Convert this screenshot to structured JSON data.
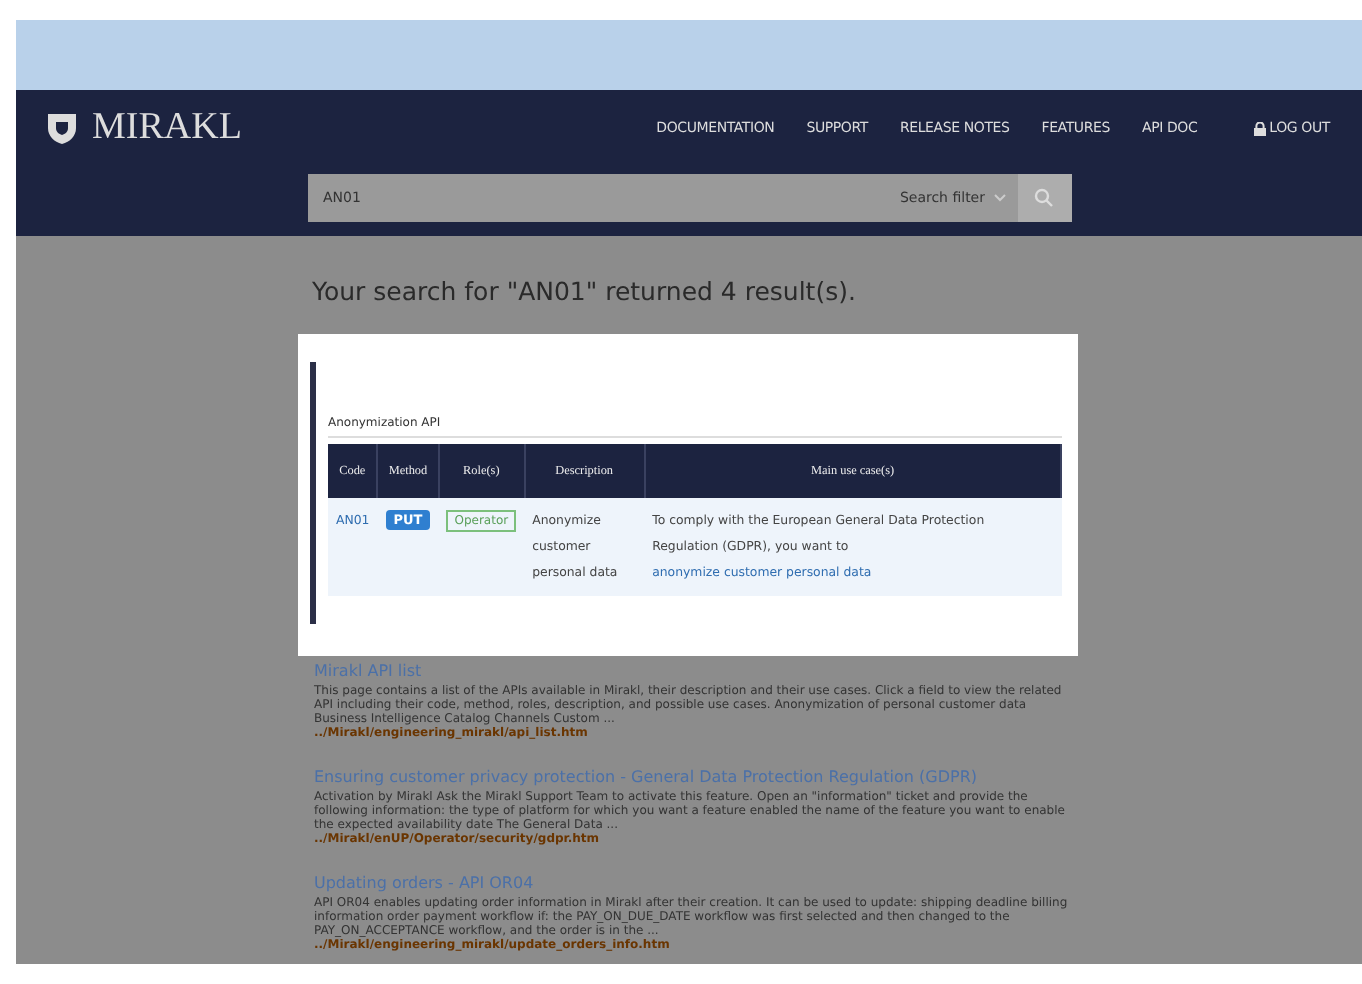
{
  "header": {
    "logo": "MIRAKL",
    "nav": [
      "DOCUMENTATION",
      "SUPPORT",
      "RELEASE NOTES",
      "FEATURES",
      "API DOC"
    ],
    "logout": "LOG OUT"
  },
  "search": {
    "value": "AN01",
    "filter": "Search filter"
  },
  "heading": "Your search for \"AN01\" returned 4 result(s).",
  "modal": {
    "section": "Anonymization API",
    "columns": [
      "Code",
      "Method",
      "Role(s)",
      "Description",
      "Main use case(s)"
    ],
    "rows": [
      {
        "code": "AN01",
        "method": "PUT",
        "role": "Operator",
        "description": "Anonymize customer personal data",
        "use_case": "To comply with the European General Data Protection Regulation (GDPR), you want to ",
        "use_case_link": "anonymize customer personal data"
      }
    ]
  },
  "results": [
    {
      "title": "Mirakl API list",
      "snippet": "This page contains a list of the APIs available in Mirakl, their description and their use cases. Click a field to view the related API including their code, method, roles, description, and possible use cases. Anonymization of personal customer data Business Intelligence Catalog Channels Custom ...",
      "url": "../Mirakl/engineering_mirakl/api_list.htm"
    },
    {
      "title": "Ensuring customer privacy protection - General Data Protection Regulation (GDPR)",
      "snippet": "Activation by Mirakl Ask the Mirakl Support Team to activate this feature. Open an \"information\" ticket and provide the following information: the type of platform for which you want a feature enabled the name of the feature you want to enable the expected availability date The General Data ...",
      "url": "../Mirakl/enUP/Operator/security/gdpr.htm"
    },
    {
      "title": "Updating orders - API OR04",
      "snippet": "API OR04 enables updating order information in Mirakl after their creation. It can be used to update: shipping deadline billing information order payment workflow if: the PAY_ON_DUE_DATE workflow was first selected and then changed to the PAY_ON_ACCEPTANCE workflow, and the order is in the ...",
      "url": "../Mirakl/engineering_mirakl/update_orders_info.htm"
    }
  ]
}
